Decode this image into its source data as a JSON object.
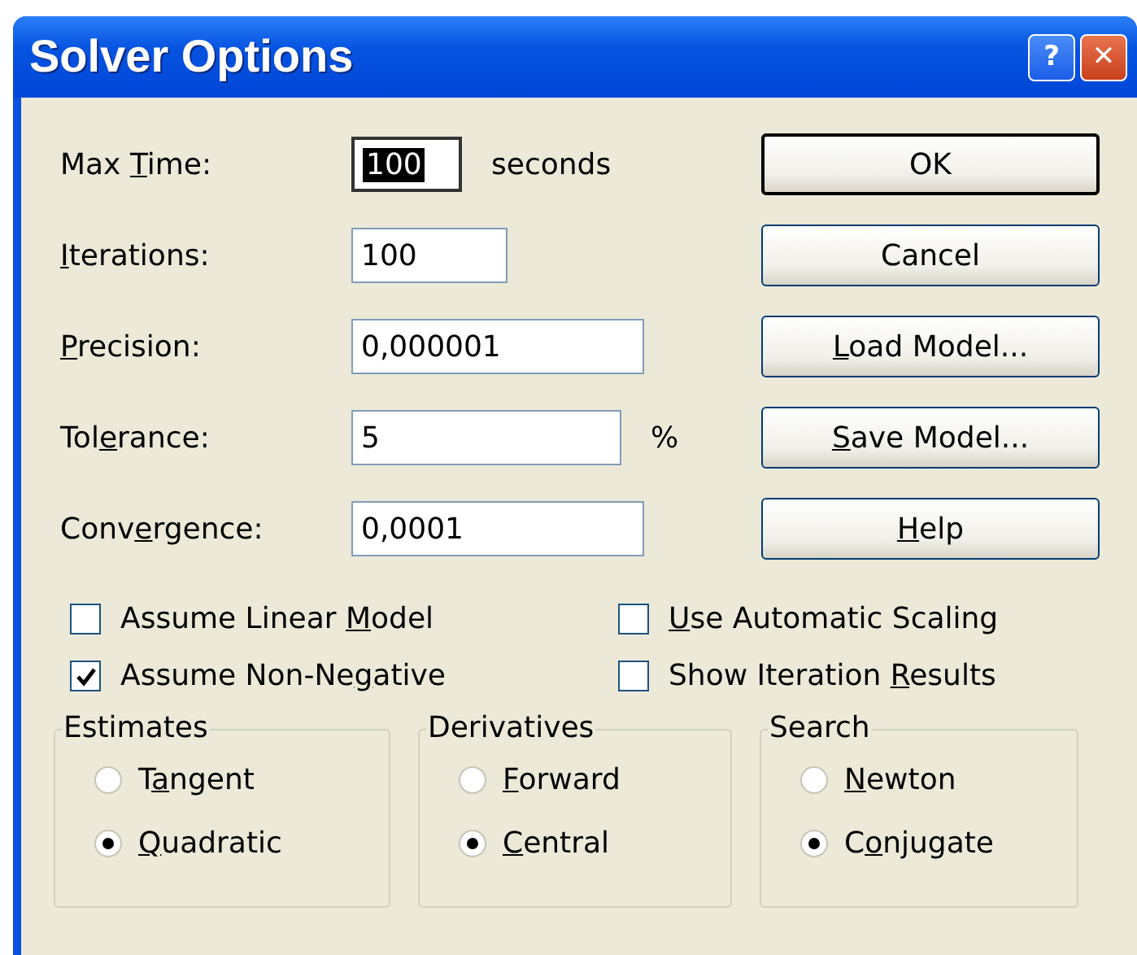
{
  "window": {
    "title": "Solver Options",
    "title_buttons": [
      {
        "kind": "help",
        "label": "?"
      },
      {
        "kind": "close",
        "label": "✕"
      }
    ]
  },
  "fields": [
    {
      "label": {
        "before": "Max ",
        "key": "T",
        "after": "ime:"
      },
      "value": "100",
      "unit": "seconds",
      "selected": true
    },
    {
      "label": {
        "key": "I",
        "after": "terations:"
      },
      "value": "100",
      "selected": false
    },
    {
      "label": {
        "key": "P",
        "after": "recision:"
      },
      "value": "0,000001",
      "selected": false
    },
    {
      "label": {
        "before": "Tol",
        "key": "e",
        "after": "rance:"
      },
      "value": "5",
      "unit": "%",
      "selected": false
    },
    {
      "label": {
        "before": "Conv",
        "key": "e",
        "after": "rgence:"
      },
      "value": "0,0001",
      "selected": false
    }
  ],
  "buttons": [
    {
      "label": {
        "after": "OK"
      },
      "default": true
    },
    {
      "label": {
        "after": "Cancel"
      },
      "default": false
    },
    {
      "label": {
        "key": "L",
        "after": "oad Model..."
      },
      "default": false
    },
    {
      "label": {
        "key": "S",
        "after": "ave Model..."
      },
      "default": false
    },
    {
      "label": {
        "key": "H",
        "after": "elp"
      },
      "default": false
    }
  ],
  "checkboxes": [
    {
      "label": {
        "before": "Assume Linear ",
        "key": "M",
        "after": "odel"
      },
      "checked": false
    },
    {
      "label": {
        "key": "U",
        "after": "se Automatic Scaling"
      },
      "checked": false
    },
    {
      "label": {
        "before": "Assume Non-Ne",
        "key": "g",
        "after": "ative"
      },
      "checked": true
    },
    {
      "label": {
        "before": "Show Iteration ",
        "key": "R",
        "after": "esults"
      },
      "checked": false
    }
  ],
  "groups": [
    {
      "title": "Estimates",
      "options": [
        {
          "label": {
            "before": "T",
            "key": "a",
            "after": "ngent"
          },
          "selected": false
        },
        {
          "label": {
            "key": "Q",
            "after": "uadratic"
          },
          "selected": true
        }
      ]
    },
    {
      "title": "Derivatives",
      "options": [
        {
          "label": {
            "key": "F",
            "after": "orward"
          },
          "selected": false
        },
        {
          "label": {
            "key": "C",
            "after": "entral"
          },
          "selected": true
        }
      ]
    },
    {
      "title": "Search",
      "options": [
        {
          "label": {
            "key": "N",
            "after": "ewton"
          },
          "selected": false
        },
        {
          "label": {
            "before": "C",
            "key": "o",
            "after": "njugate"
          },
          "selected": true
        }
      ]
    }
  ]
}
